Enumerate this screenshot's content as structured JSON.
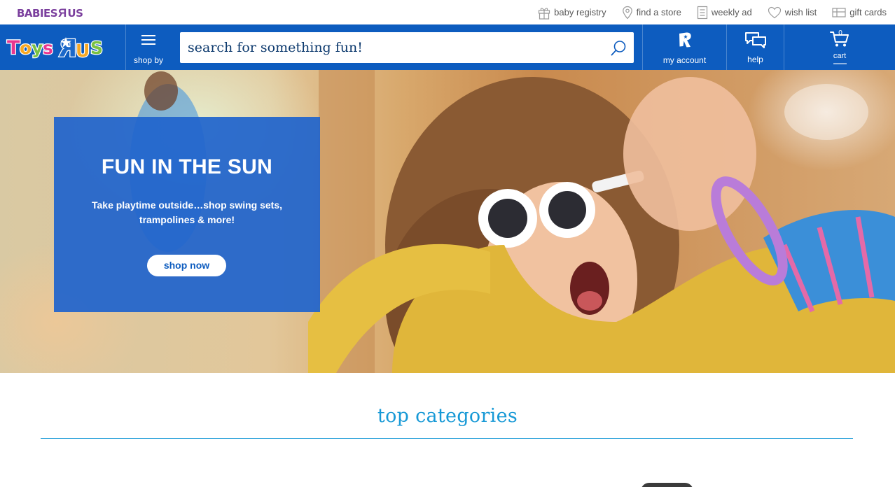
{
  "utility": {
    "babies_logo_text": "BABIES",
    "babies_logo_r": "R",
    "babies_logo_us": "US",
    "links": [
      {
        "label": "baby registry",
        "icon": "gift-icon"
      },
      {
        "label": "find a store",
        "icon": "map-pin-icon"
      },
      {
        "label": "weekly ad",
        "icon": "document-icon"
      },
      {
        "label": "wish list",
        "icon": "heart-icon"
      },
      {
        "label": "gift cards",
        "icon": "gift-card-icon"
      }
    ]
  },
  "header": {
    "logo_text": "ToysRUs",
    "shop_by": "shop by",
    "search_placeholder": "search for something fun!",
    "my_account": "my account",
    "help": "help",
    "cart_label": "cart",
    "cart_count": "0"
  },
  "hero": {
    "title": "FUN IN THE SUN",
    "description": "Take playtime outside…shop swing sets, trampolines & more!",
    "cta": "shop now"
  },
  "categories": {
    "title": "top categories"
  },
  "colors": {
    "header_blue": "#0d5cbf",
    "promo_blue": "#2064cc",
    "category_blue": "#1799d6",
    "babies_purple": "#7a3e9d"
  }
}
